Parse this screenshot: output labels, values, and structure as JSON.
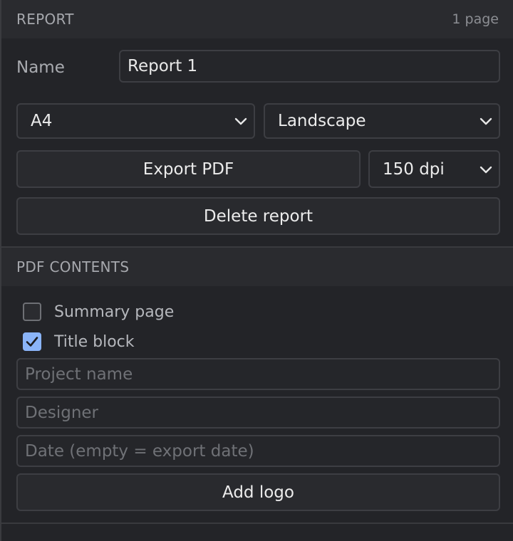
{
  "report": {
    "section_title": "REPORT",
    "page_count": "1 page",
    "name_label": "Name",
    "name_value": "Report 1",
    "paper_size": "A4",
    "orientation": "Landscape",
    "export_label": "Export PDF",
    "dpi": "150 dpi",
    "delete_label": "Delete report"
  },
  "pdf_contents": {
    "section_title": "PDF CONTENTS",
    "summary_page_label": "Summary page",
    "summary_page_checked": false,
    "title_block_label": "Title block",
    "title_block_checked": true,
    "project_name_placeholder": "Project name",
    "designer_placeholder": "Designer",
    "date_placeholder": "Date (empty = export date)",
    "add_logo_label": "Add logo"
  },
  "colors": {
    "background": "#232428",
    "header": "#2a2b2f",
    "border": "#3d3e43",
    "accent": "#8ab4f8"
  }
}
